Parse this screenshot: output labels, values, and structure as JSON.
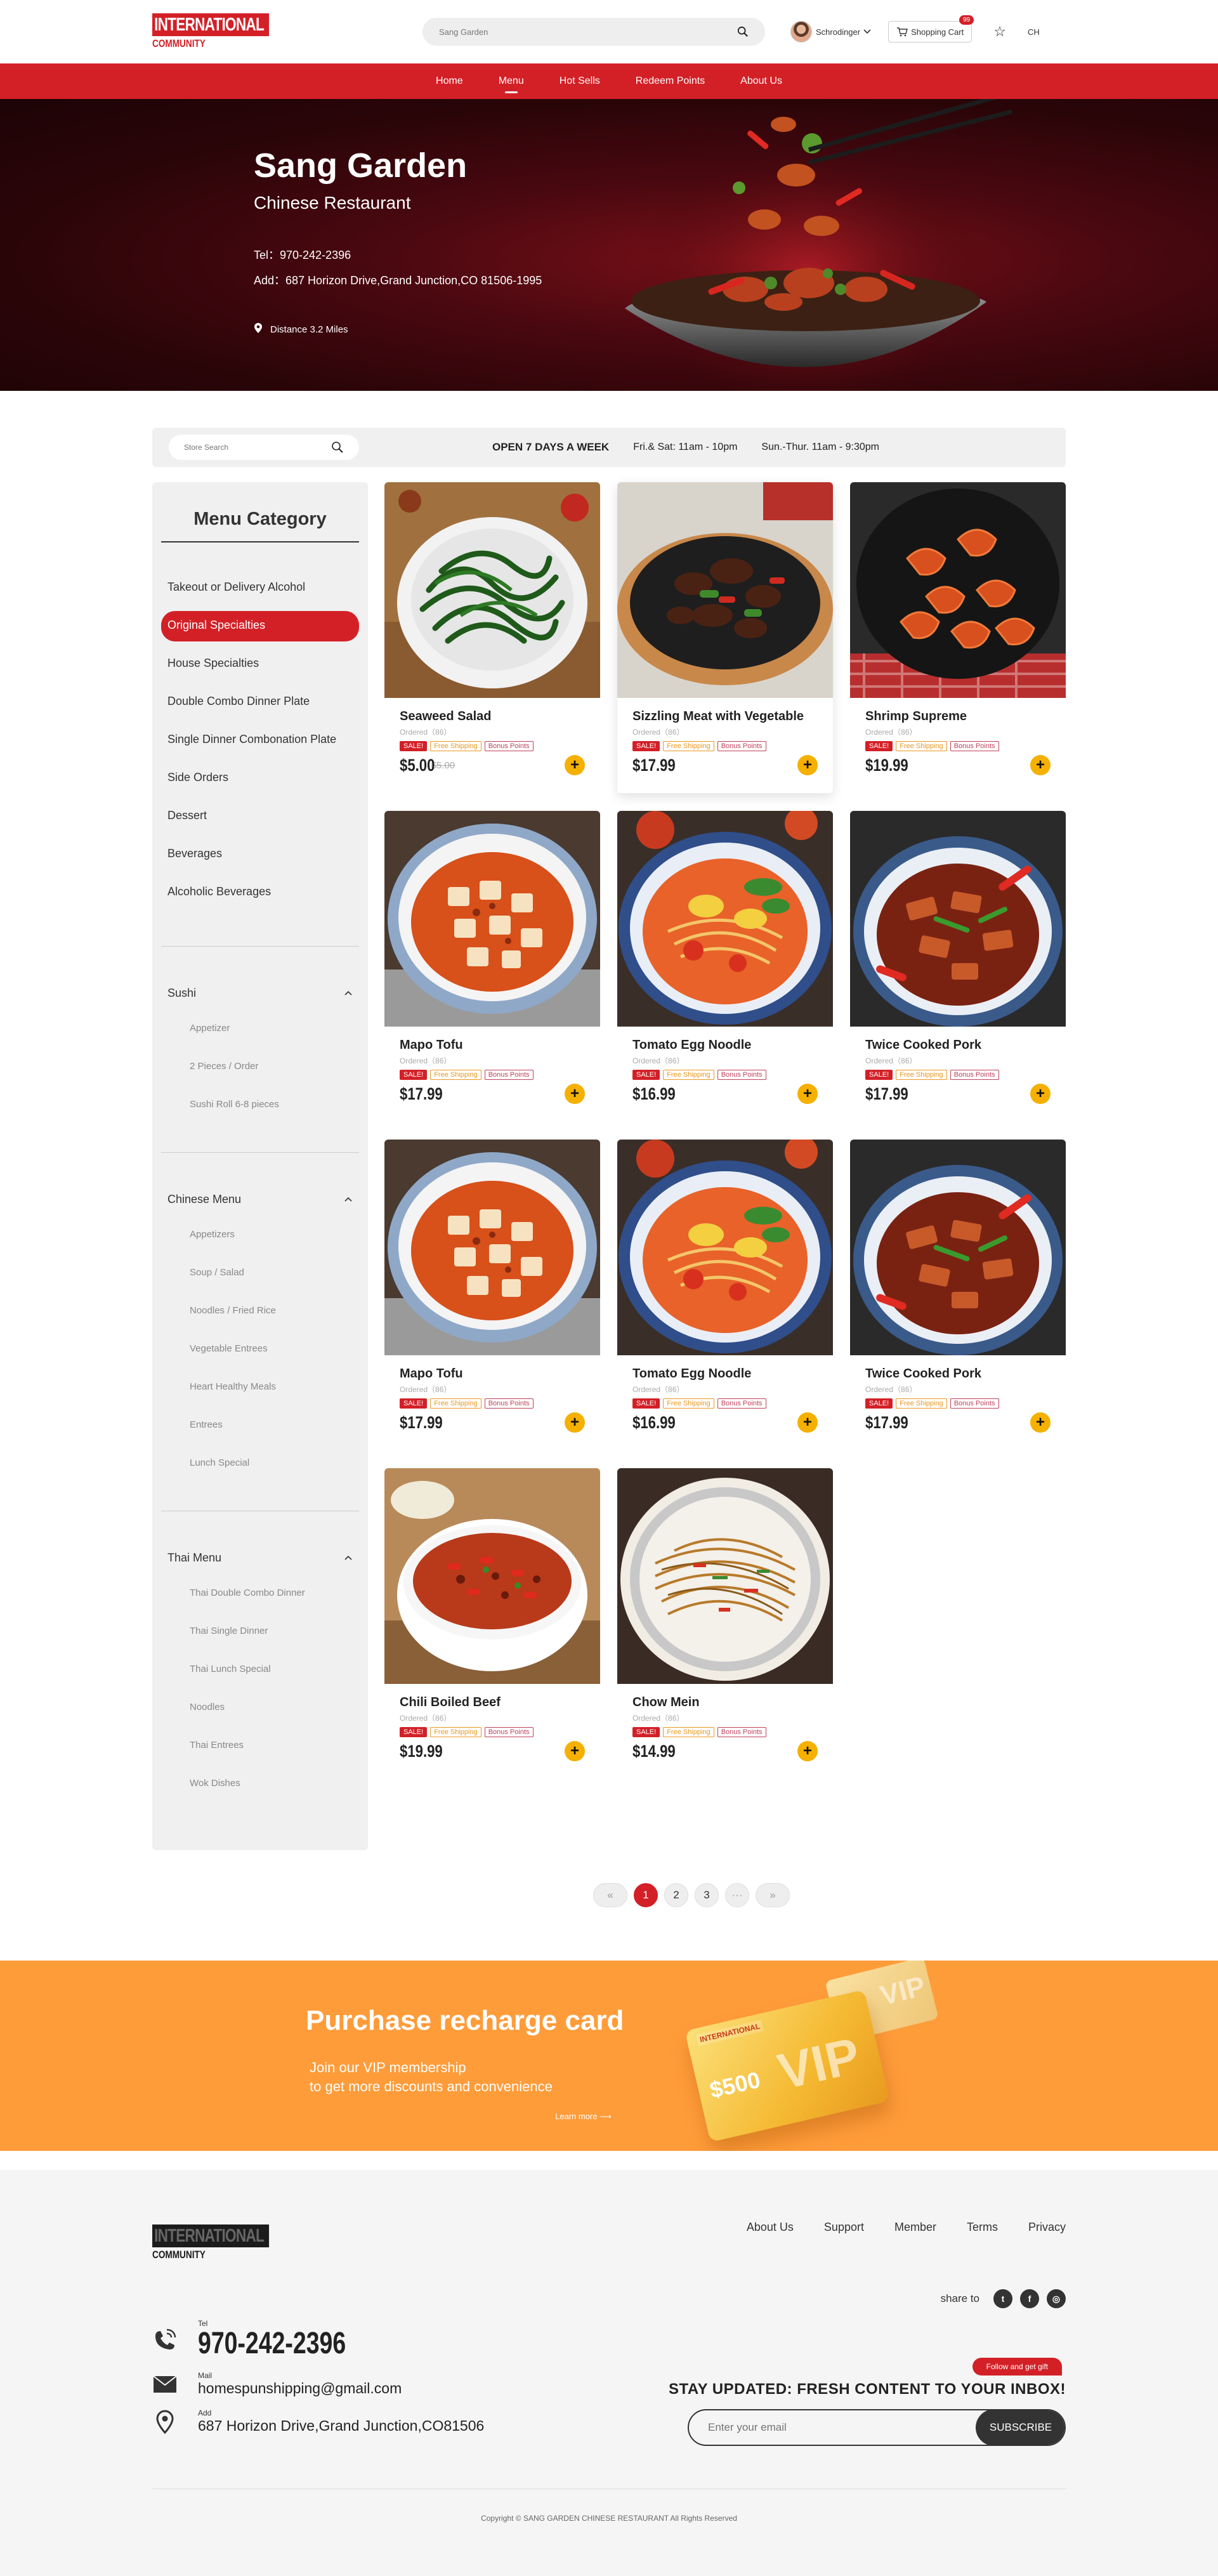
{
  "header": {
    "logo_line1": "INTERNATIONAL",
    "logo_line2": "COMMUNITY",
    "search_placeholder": "Sang Garden",
    "user_name": "Schrodinger",
    "cart_label": "Shopping Cart",
    "cart_count": "99",
    "lang": "CH"
  },
  "nav": [
    "Home",
    "Menu",
    "Hot Sells",
    "Redeem Points",
    "About Us"
  ],
  "hero": {
    "name": "Sang Garden",
    "subtitle": "Chinese Restaurant",
    "tel": "Tel：970-242-2396",
    "address": "Add：687 Horizon Drive,Grand Junction,CO 81506-1995",
    "distance": "Distance 3.2 Miles"
  },
  "infobar": {
    "search_placeholder": "Store Search",
    "open": "OPEN 7 DAYS A WEEK",
    "hours1": "Fri.& Sat: 11am - 10pm",
    "hours2": "Sun.-Thur. 11am - 9:30pm"
  },
  "sidebar": {
    "title": "Menu Category",
    "categories": [
      "Takeout or Delivery Alcohol",
      "Original Specialties",
      "House Specialties",
      "Double Combo Dinner Plate",
      "Single Dinner Combonation Plate",
      "Side Orders",
      "Dessert",
      "Beverages",
      "Alcoholic Beverages"
    ],
    "groups": [
      {
        "name": "Sushi",
        "items": [
          "Appetizer",
          "2 Pieces / Order",
          "Sushi Roll 6-8 pieces"
        ]
      },
      {
        "name": "Chinese Menu",
        "items": [
          "Appetizers",
          "Soup / Salad",
          "Noodles / Fried Rice",
          "Vegetable Entrees",
          "Heart Healthy Meals",
          "Entrees",
          "Lunch Special"
        ]
      },
      {
        "name": "Thai Menu",
        "items": [
          "Thai Double Combo Dinner",
          "Thai Single Dinner",
          "Thai Lunch Special",
          "Noodles",
          "Thai Entrees",
          "Wok Dishes"
        ]
      }
    ]
  },
  "tags": {
    "sale": "SALE!",
    "ship": "Free Shipping",
    "bonus": "Bonus Points"
  },
  "products": [
    {
      "name": "Seaweed Salad",
      "ordered": "Ordered（86）",
      "price": "$5.00",
      "old_price": "$5.00",
      "image": "seaweed-salad"
    },
    {
      "name": "Sizzling Meat with Vegetable",
      "ordered": "Ordered（86）",
      "price": "$17.99",
      "image": "sizzling-meat"
    },
    {
      "name": "Shrimp Supreme",
      "ordered": "Ordered（86）",
      "price": "$19.99",
      "image": "shrimp"
    },
    {
      "name": "Mapo Tofu",
      "ordered": "Ordered（86）",
      "price": "$17.99",
      "image": "mapo-tofu"
    },
    {
      "name": "Tomato Egg Noodle",
      "ordered": "Ordered（86）",
      "price": "$16.99",
      "image": "tomato-noodle"
    },
    {
      "name": "Twice Cooked Pork",
      "ordered": "Ordered（86）",
      "price": "$17.99",
      "image": "twice-pork"
    },
    {
      "name": "Mapo Tofu",
      "ordered": "Ordered（86）",
      "price": "$17.99",
      "image": "mapo-tofu"
    },
    {
      "name": "Tomato Egg Noodle",
      "ordered": "Ordered（86）",
      "price": "$16.99",
      "image": "tomato-noodle"
    },
    {
      "name": "Twice Cooked Pork",
      "ordered": "Ordered（86）",
      "price": "$17.99",
      "image": "twice-pork"
    },
    {
      "name": "Chili Boiled Beef",
      "ordered": "Ordered（86）",
      "price": "$19.99",
      "image": "chili-beef"
    },
    {
      "name": "Chow Mein",
      "ordered": "Ordered（86）",
      "price": "$14.99",
      "image": "chow-mein"
    }
  ],
  "pagination": {
    "prev": "«",
    "pages": [
      "1",
      "2",
      "3"
    ],
    "current": "1",
    "ellipsis": "···",
    "next": "»"
  },
  "recharge": {
    "title": "Purchase recharge card",
    "line1": "Join our VIP membership",
    "line2": "to get more discounts and convenience",
    "more": "Learn more",
    "card_value": "$500",
    "card_brand": "VIP"
  },
  "footer": {
    "links": [
      "About Us",
      "Support",
      "Member",
      "Terms",
      "Privacy"
    ],
    "share_label": "share to",
    "tel_label": "Tel",
    "tel": "970-242-2396",
    "mail_label": "Mail",
    "mail": "homespunshipping@gmail.com",
    "add_label": "Add",
    "address": "687 Horizon Drive,Grand Junction,CO81506",
    "gift": "Follow and get gift",
    "subscribe_title": "STAY UPDATED: FRESH CONTENT TO YOUR INBOX!",
    "email_placeholder": "Enter your email",
    "subscribe_button": "SUBSCRIBE",
    "copyright": "Copyright © SANG GARDEN CHINESE RESTAURANT  All Rights Reserved"
  },
  "colors": {
    "brand": "#d32027",
    "accent": "#f5b000",
    "banner": "#ff9c3a"
  }
}
